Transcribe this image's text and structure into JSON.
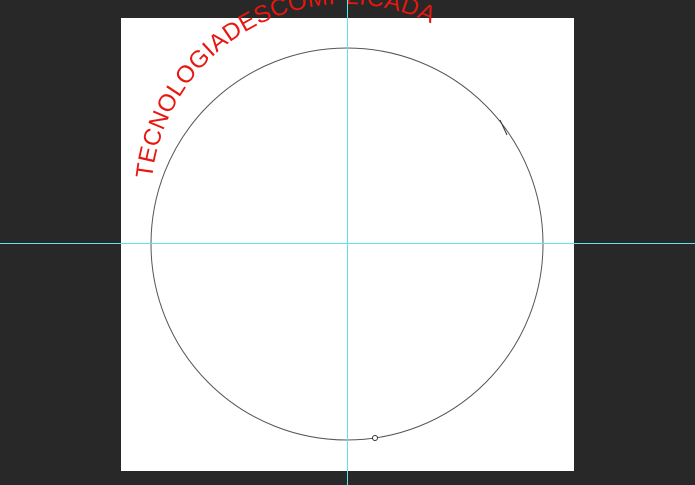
{
  "canvas": {
    "arc_text": "TECNOLOGIADESCOMPLICADA",
    "text_color": "#e8170f"
  },
  "colors": {
    "workspace_background": "#282828",
    "document_background": "#ffffff",
    "guide_color": "#5ee3f0",
    "path_stroke": "#555555"
  },
  "tool": {
    "text_cursor_icon": "i-beam-cursor-icon",
    "anchor_icon": "path-anchor-icon"
  }
}
